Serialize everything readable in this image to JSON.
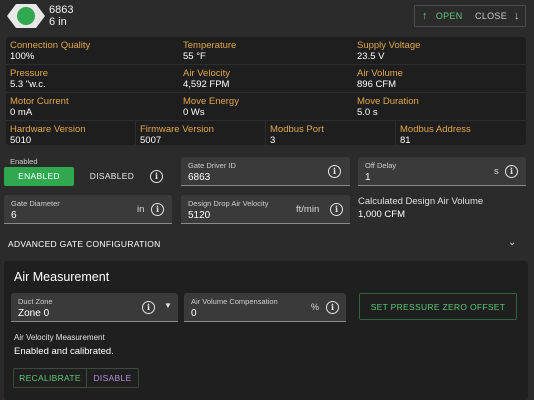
{
  "header": {
    "gate_id": "6863",
    "gate_size": "6 in",
    "open_label": "OPEN",
    "close_label": "CLOSE",
    "status_color": "#2fa84f"
  },
  "stats": [
    {
      "label": "Connection Quality",
      "value": "100%"
    },
    {
      "label": "Temperature",
      "value": "55 °F"
    },
    {
      "label": "Supply Voltage",
      "value": "23.5 V"
    },
    {
      "label": "Pressure",
      "value": "5.3 \"w.c."
    },
    {
      "label": "Air Velocity",
      "value": "4,592 FPM"
    },
    {
      "label": "Air Volume",
      "value": "896 CFM"
    },
    {
      "label": "Motor Current",
      "value": "0 mA"
    },
    {
      "label": "Move Energy",
      "value": "0 Ws"
    },
    {
      "label": "Move Duration",
      "value": "5.0 s"
    },
    {
      "label": "Hardware Version",
      "value": "5010"
    },
    {
      "label": "Firmware Version",
      "value": "5007"
    },
    {
      "label": "Modbus Port",
      "value": "3"
    },
    {
      "label": "Modbus Address",
      "value": "81"
    }
  ],
  "settings": {
    "enabled_label": "Enabled",
    "enabled_option": "ENABLED",
    "disabled_option": "DISABLED",
    "gate_driver_id": {
      "label": "Gate Driver ID",
      "value": "6863"
    },
    "off_delay": {
      "label": "Off Delay",
      "value": "1",
      "unit": "s"
    },
    "gate_diameter": {
      "label": "Gate Diameter",
      "value": "6",
      "unit": "in"
    },
    "design_velocity": {
      "label": "Design Drop Air Velocity",
      "value": "5120",
      "unit": "ft/min"
    },
    "calc_volume_label": "Calculated Design Air Volume",
    "calc_volume_value": "1,000 CFM"
  },
  "advanced": {
    "label": "ADVANCED GATE CONFIGURATION"
  },
  "air_measurement": {
    "title": "Air Measurement",
    "duct_zone": {
      "label": "Duct Zone",
      "value": "Zone 0"
    },
    "volume_comp": {
      "label": "Air Volume Compensation",
      "value": "0",
      "unit": "%"
    },
    "zero_offset_label": "SET PRESSURE ZERO OFFSET",
    "velocity_label": "Air Velocity Measurement",
    "velocity_status": "Enabled and calibrated.",
    "recalibrate_label": "RECALIBRATE",
    "disable_label": "DISABLE"
  },
  "colors": {
    "accent_green": "#2fa84f",
    "label_orange": "#e3a74b",
    "disable_purple": "#b48ed8"
  }
}
